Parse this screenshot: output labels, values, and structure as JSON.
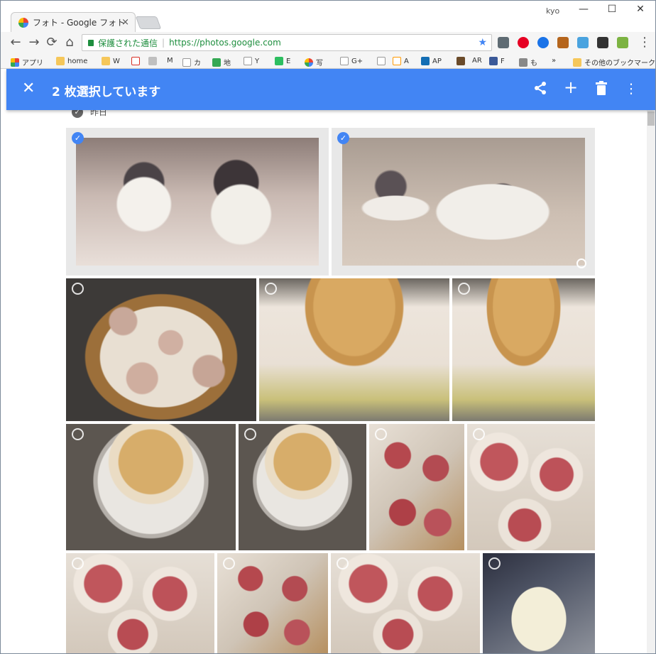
{
  "browser": {
    "tab_title": "フォト - Google フォト",
    "tab_close": "×",
    "user": "kyo",
    "minimize": "—",
    "maximize": "☐",
    "close": "✕",
    "nav_back": "←",
    "nav_forward": "→",
    "nav_reload": "⟳",
    "nav_home": "⌂",
    "secure_label": "保護された通信",
    "url": "https://photos.google.com",
    "menu": "⋮"
  },
  "bookmarks": [
    {
      "label": "アプリ",
      "icon": "apps-grid-icon",
      "color": "#e94235"
    },
    {
      "label": "home",
      "icon": "folder-icon",
      "color": "#f6c75a"
    },
    {
      "label": "W",
      "icon": "folder-icon",
      "color": "#f6c75a"
    },
    {
      "label": "M",
      "icon": "gmail-icon",
      "color": "#d93025"
    },
    {
      "label": "",
      "icon": "mail-icon",
      "color": "#c0c0c0"
    },
    {
      "label": "M",
      "icon": "page-icon",
      "color": "#ffffff"
    },
    {
      "label": "カ",
      "icon": "page-icon",
      "color": "#ffffff"
    },
    {
      "label": "地",
      "icon": "maps-icon",
      "color": "#34a853"
    },
    {
      "label": "Y",
      "icon": "page-icon",
      "color": "#ffffff"
    },
    {
      "label": "E",
      "icon": "evernote-icon",
      "color": "#2dbe60"
    },
    {
      "label": "写",
      "icon": "photos-icon",
      "color": "#fbbc05"
    },
    {
      "label": "G+",
      "icon": "page-icon",
      "color": "#ffffff"
    },
    {
      "label": "",
      "icon": "page-icon",
      "color": "#ffffff"
    },
    {
      "label": "A",
      "icon": "amazon-icon",
      "color": "#f90"
    },
    {
      "label": "AP",
      "icon": "amazon-pay-icon",
      "color": "#146eb4"
    },
    {
      "label": "",
      "icon": "k-icon",
      "color": "#6b4b2a"
    },
    {
      "label": "AR",
      "icon": "page-icon",
      "color": "#ffffff"
    },
    {
      "label": "F",
      "icon": "facebook-icon",
      "color": "#3b5998"
    },
    {
      "label": "も",
      "icon": "image-icon",
      "color": "#888888"
    },
    {
      "label": "»",
      "icon": "",
      "color": ""
    },
    {
      "label": "その他のブックマーク",
      "icon": "folder-icon",
      "color": "#f6c75a"
    }
  ],
  "appbar": {
    "title": "2 枚選択しています",
    "close_icon": "✕",
    "share_icon": "share",
    "add_icon": "+",
    "delete_icon": "delete",
    "more_icon": "⋮",
    "color": "#4285f4"
  },
  "section": {
    "date_label": "昨日"
  },
  "photos": [
    {
      "subject": "two-cats",
      "selected": true
    },
    {
      "subject": "two-cats-lying",
      "selected": true
    },
    {
      "subject": "shumai-steamer",
      "selected": false
    },
    {
      "subject": "steamer-on-pot",
      "selected": false
    },
    {
      "subject": "steamer-on-pot",
      "selected": false
    },
    {
      "subject": "steamer-top",
      "selected": false
    },
    {
      "subject": "steamer-top",
      "selected": false
    },
    {
      "subject": "raw-shumai",
      "selected": false
    },
    {
      "subject": "raw-shumai",
      "selected": false
    },
    {
      "subject": "raw-shumai-closeup",
      "selected": false
    },
    {
      "subject": "raw-shumai-tray",
      "selected": false
    },
    {
      "subject": "raw-shumai-tray",
      "selected": false
    },
    {
      "subject": "wrappers-package",
      "selected": false
    }
  ]
}
